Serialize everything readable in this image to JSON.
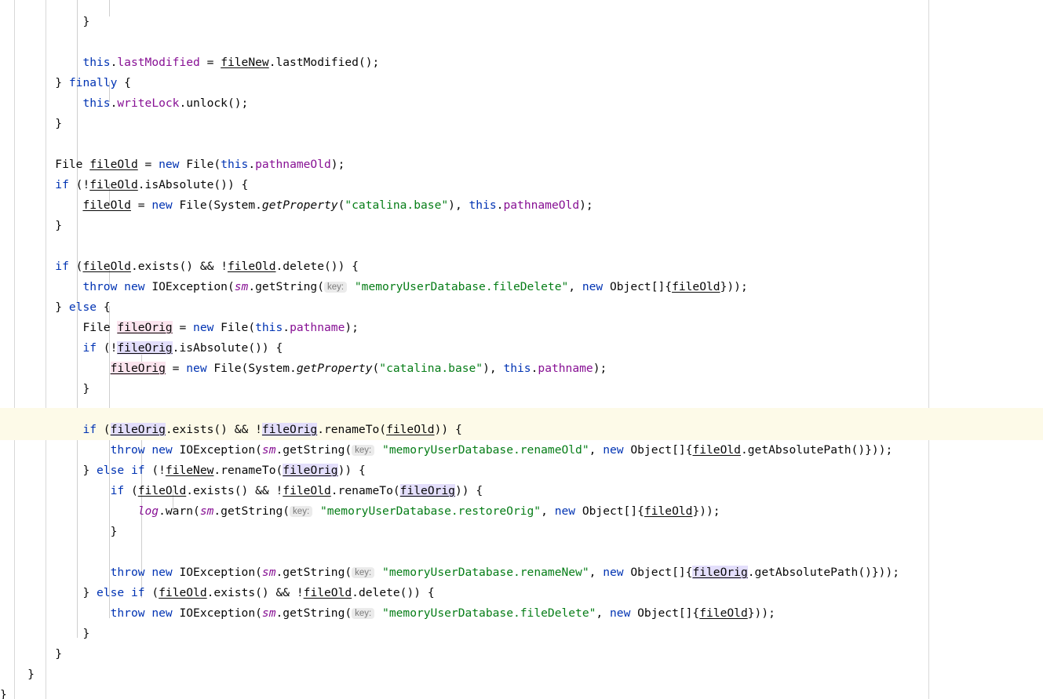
{
  "editor": {
    "language": "java",
    "font_size_px": 14.6,
    "line_height_px": 26,
    "background": "#ffffff",
    "caret_line_background": "#fdfae8",
    "indent_guide_color": "#d8d8d8",
    "right_margin_guide_x": 1183,
    "indent_guide_positions": [
      18,
      58,
      98,
      139,
      180
    ],
    "colors": {
      "keyword": "#0033B3",
      "string": "#067D17",
      "field": "#871094",
      "text": "#080808",
      "inline_hint_text": "#7a7a7a",
      "inline_hint_background": "#ebebeb",
      "read_occurrence": "#e3defb",
      "write_occurrence": "#fbe4ee"
    },
    "caret_line_index": 20
  },
  "inline_hints": {
    "key_label": "key:"
  },
  "code_lines": [
    {
      "indent": 3,
      "tokens": [
        {
          "t": "}",
          "c": "pln"
        }
      ]
    },
    {
      "indent": 0,
      "tokens": []
    },
    {
      "indent": 3,
      "tokens": [
        {
          "t": "this",
          "c": "kw"
        },
        {
          "t": ".",
          "c": "pln"
        },
        {
          "t": "lastModified",
          "c": "fld"
        },
        {
          "t": " = ",
          "c": "pln"
        },
        {
          "t": "fileNew",
          "c": "lv"
        },
        {
          "t": ".lastModified();",
          "c": "pln"
        }
      ]
    },
    {
      "indent": 2,
      "tokens": [
        {
          "t": "} ",
          "c": "pln"
        },
        {
          "t": "finally",
          "c": "kw"
        },
        {
          "t": " {",
          "c": "pln"
        }
      ]
    },
    {
      "indent": 3,
      "tokens": [
        {
          "t": "this",
          "c": "kw"
        },
        {
          "t": ".",
          "c": "pln"
        },
        {
          "t": "writeLock",
          "c": "fld"
        },
        {
          "t": ".unlock();",
          "c": "pln"
        }
      ]
    },
    {
      "indent": 2,
      "tokens": [
        {
          "t": "}",
          "c": "pln"
        }
      ]
    },
    {
      "indent": 0,
      "tokens": []
    },
    {
      "indent": 2,
      "tokens": [
        {
          "t": "File ",
          "c": "pln"
        },
        {
          "t": "fileOld",
          "c": "lv"
        },
        {
          "t": " = ",
          "c": "pln"
        },
        {
          "t": "new",
          "c": "kw"
        },
        {
          "t": " File(",
          "c": "pln"
        },
        {
          "t": "this",
          "c": "kw"
        },
        {
          "t": ".",
          "c": "pln"
        },
        {
          "t": "pathnameOld",
          "c": "fld"
        },
        {
          "t": ");",
          "c": "pln"
        }
      ]
    },
    {
      "indent": 2,
      "tokens": [
        {
          "t": "if",
          "c": "kw"
        },
        {
          "t": " (!",
          "c": "pln"
        },
        {
          "t": "fileOld",
          "c": "lv"
        },
        {
          "t": ".isAbsolute()) {",
          "c": "pln"
        }
      ]
    },
    {
      "indent": 3,
      "tokens": [
        {
          "t": "fileOld",
          "c": "lv"
        },
        {
          "t": " = ",
          "c": "pln"
        },
        {
          "t": "new",
          "c": "kw"
        },
        {
          "t": " File(System.",
          "c": "pln"
        },
        {
          "t": "getProperty",
          "c": "stm"
        },
        {
          "t": "(",
          "c": "pln"
        },
        {
          "t": "\"catalina.base\"",
          "c": "str"
        },
        {
          "t": "), ",
          "c": "pln"
        },
        {
          "t": "this",
          "c": "kw"
        },
        {
          "t": ".",
          "c": "pln"
        },
        {
          "t": "pathnameOld",
          "c": "fld"
        },
        {
          "t": ");",
          "c": "pln"
        }
      ]
    },
    {
      "indent": 2,
      "tokens": [
        {
          "t": "}",
          "c": "pln"
        }
      ]
    },
    {
      "indent": 0,
      "tokens": []
    },
    {
      "indent": 2,
      "tokens": [
        {
          "t": "if",
          "c": "kw"
        },
        {
          "t": " (",
          "c": "pln"
        },
        {
          "t": "fileOld",
          "c": "lv"
        },
        {
          "t": ".exists() && !",
          "c": "pln"
        },
        {
          "t": "fileOld",
          "c": "lv"
        },
        {
          "t": ".delete()) {",
          "c": "pln"
        }
      ]
    },
    {
      "indent": 3,
      "tokens": [
        {
          "t": "throw",
          "c": "kw"
        },
        {
          "t": " ",
          "c": "pln"
        },
        {
          "t": "new",
          "c": "kw"
        },
        {
          "t": " IOException(",
          "c": "pln"
        },
        {
          "t": "sm",
          "c": "fldi"
        },
        {
          "t": ".getString(",
          "c": "pln"
        },
        {
          "t": "key:",
          "c": "hint"
        },
        {
          "t": "\"memoryUserDatabase.fileDelete\"",
          "c": "str"
        },
        {
          "t": ", ",
          "c": "pln"
        },
        {
          "t": "new",
          "c": "kw"
        },
        {
          "t": " Object[]{",
          "c": "pln"
        },
        {
          "t": "fileOld",
          "c": "lv"
        },
        {
          "t": "}));",
          "c": "pln"
        }
      ]
    },
    {
      "indent": 2,
      "tokens": [
        {
          "t": "} ",
          "c": "pln"
        },
        {
          "t": "else",
          "c": "kw"
        },
        {
          "t": " {",
          "c": "pln"
        }
      ]
    },
    {
      "indent": 3,
      "tokens": [
        {
          "t": "File ",
          "c": "pln"
        },
        {
          "t": "fileOrig",
          "c": "lv occ-w"
        },
        {
          "t": " = ",
          "c": "pln"
        },
        {
          "t": "new",
          "c": "kw"
        },
        {
          "t": " File(",
          "c": "pln"
        },
        {
          "t": "this",
          "c": "kw"
        },
        {
          "t": ".",
          "c": "pln"
        },
        {
          "t": "pathname",
          "c": "fld"
        },
        {
          "t": ");",
          "c": "pln"
        }
      ]
    },
    {
      "indent": 3,
      "tokens": [
        {
          "t": "if",
          "c": "kw"
        },
        {
          "t": " (!",
          "c": "pln"
        },
        {
          "t": "fileOrig",
          "c": "lv occ-r"
        },
        {
          "t": ".isAbsolute()) {",
          "c": "pln"
        }
      ]
    },
    {
      "indent": 4,
      "tokens": [
        {
          "t": "fileOrig",
          "c": "lv occ-w"
        },
        {
          "t": " = ",
          "c": "pln"
        },
        {
          "t": "new",
          "c": "kw"
        },
        {
          "t": " File(System.",
          "c": "pln"
        },
        {
          "t": "getProperty",
          "c": "stm"
        },
        {
          "t": "(",
          "c": "pln"
        },
        {
          "t": "\"catalina.base\"",
          "c": "str"
        },
        {
          "t": "), ",
          "c": "pln"
        },
        {
          "t": "this",
          "c": "kw"
        },
        {
          "t": ".",
          "c": "pln"
        },
        {
          "t": "pathname",
          "c": "fld"
        },
        {
          "t": ");",
          "c": "pln"
        }
      ]
    },
    {
      "indent": 3,
      "tokens": [
        {
          "t": "}",
          "c": "pln"
        }
      ]
    },
    {
      "indent": 0,
      "tokens": []
    },
    {
      "indent": 3,
      "tokens": [
        {
          "t": "if",
          "c": "kw"
        },
        {
          "t": " (",
          "c": "pln"
        },
        {
          "t": "fileOrig",
          "c": "lv occ-r"
        },
        {
          "t": ".exists() && !",
          "c": "pln"
        },
        {
          "t": "fileOrig",
          "c": "lv occ-r"
        },
        {
          "t": ".renameTo(",
          "c": "pln"
        },
        {
          "t": "fileOld",
          "c": "lv"
        },
        {
          "t": ")) {",
          "c": "pln"
        }
      ]
    },
    {
      "indent": 4,
      "tokens": [
        {
          "t": "throw",
          "c": "kw"
        },
        {
          "t": " ",
          "c": "pln"
        },
        {
          "t": "new",
          "c": "kw"
        },
        {
          "t": " IOException(",
          "c": "pln"
        },
        {
          "t": "sm",
          "c": "fldi"
        },
        {
          "t": ".getString(",
          "c": "pln"
        },
        {
          "t": "key:",
          "c": "hint"
        },
        {
          "t": "\"memoryUserDatabase.renameOld\"",
          "c": "str"
        },
        {
          "t": ", ",
          "c": "pln"
        },
        {
          "t": "new",
          "c": "kw"
        },
        {
          "t": " Object[]{",
          "c": "pln"
        },
        {
          "t": "fileOld",
          "c": "lv"
        },
        {
          "t": ".getAbsolutePath()}));",
          "c": "pln"
        }
      ]
    },
    {
      "indent": 3,
      "tokens": [
        {
          "t": "} ",
          "c": "pln"
        },
        {
          "t": "else",
          "c": "kw"
        },
        {
          "t": " ",
          "c": "pln"
        },
        {
          "t": "if",
          "c": "kw"
        },
        {
          "t": " (!",
          "c": "pln"
        },
        {
          "t": "fileNew",
          "c": "lv"
        },
        {
          "t": ".renameTo(",
          "c": "pln"
        },
        {
          "t": "fileOrig",
          "c": "lv occ-r"
        },
        {
          "t": ")) {",
          "c": "pln"
        }
      ]
    },
    {
      "indent": 4,
      "tokens": [
        {
          "t": "if",
          "c": "kw"
        },
        {
          "t": " (",
          "c": "pln"
        },
        {
          "t": "fileOld",
          "c": "lv"
        },
        {
          "t": ".exists() && !",
          "c": "pln"
        },
        {
          "t": "fileOld",
          "c": "lv"
        },
        {
          "t": ".renameTo(",
          "c": "pln"
        },
        {
          "t": "fileOrig",
          "c": "lv occ-r"
        },
        {
          "t": ")) {",
          "c": "pln"
        }
      ]
    },
    {
      "indent": 5,
      "tokens": [
        {
          "t": "log",
          "c": "fldi"
        },
        {
          "t": ".warn(",
          "c": "pln"
        },
        {
          "t": "sm",
          "c": "fldi"
        },
        {
          "t": ".getString(",
          "c": "pln"
        },
        {
          "t": "key:",
          "c": "hint"
        },
        {
          "t": "\"memoryUserDatabase.restoreOrig\"",
          "c": "str"
        },
        {
          "t": ", ",
          "c": "pln"
        },
        {
          "t": "new",
          "c": "kw"
        },
        {
          "t": " Object[]{",
          "c": "pln"
        },
        {
          "t": "fileOld",
          "c": "lv"
        },
        {
          "t": "}));",
          "c": "pln"
        }
      ]
    },
    {
      "indent": 4,
      "tokens": [
        {
          "t": "}",
          "c": "pln"
        }
      ]
    },
    {
      "indent": 0,
      "tokens": []
    },
    {
      "indent": 4,
      "tokens": [
        {
          "t": "throw",
          "c": "kw"
        },
        {
          "t": " ",
          "c": "pln"
        },
        {
          "t": "new",
          "c": "kw"
        },
        {
          "t": " IOException(",
          "c": "pln"
        },
        {
          "t": "sm",
          "c": "fldi"
        },
        {
          "t": ".getString(",
          "c": "pln"
        },
        {
          "t": "key:",
          "c": "hint"
        },
        {
          "t": "\"memoryUserDatabase.renameNew\"",
          "c": "str"
        },
        {
          "t": ", ",
          "c": "pln"
        },
        {
          "t": "new",
          "c": "kw"
        },
        {
          "t": " Object[]{",
          "c": "pln"
        },
        {
          "t": "fileOrig",
          "c": "lv occ-r"
        },
        {
          "t": ".getAbsolutePath()}));",
          "c": "pln"
        }
      ]
    },
    {
      "indent": 3,
      "tokens": [
        {
          "t": "} ",
          "c": "pln"
        },
        {
          "t": "else",
          "c": "kw"
        },
        {
          "t": " ",
          "c": "pln"
        },
        {
          "t": "if",
          "c": "kw"
        },
        {
          "t": " (",
          "c": "pln"
        },
        {
          "t": "fileOld",
          "c": "lv"
        },
        {
          "t": ".exists() && !",
          "c": "pln"
        },
        {
          "t": "fileOld",
          "c": "lv"
        },
        {
          "t": ".delete()) {",
          "c": "pln"
        }
      ]
    },
    {
      "indent": 4,
      "tokens": [
        {
          "t": "throw",
          "c": "kw"
        },
        {
          "t": " ",
          "c": "pln"
        },
        {
          "t": "new",
          "c": "kw"
        },
        {
          "t": " IOException(",
          "c": "pln"
        },
        {
          "t": "sm",
          "c": "fldi"
        },
        {
          "t": ".getString(",
          "c": "pln"
        },
        {
          "t": "key:",
          "c": "hint"
        },
        {
          "t": "\"memoryUserDatabase.fileDelete\"",
          "c": "str"
        },
        {
          "t": ", ",
          "c": "pln"
        },
        {
          "t": "new",
          "c": "kw"
        },
        {
          "t": " Object[]{",
          "c": "pln"
        },
        {
          "t": "fileOld",
          "c": "lv"
        },
        {
          "t": "}));",
          "c": "pln"
        }
      ]
    },
    {
      "indent": 3,
      "tokens": [
        {
          "t": "}",
          "c": "pln"
        }
      ]
    },
    {
      "indent": 2,
      "tokens": [
        {
          "t": "}",
          "c": "pln"
        }
      ]
    },
    {
      "indent": 1,
      "tokens": [
        {
          "t": "}",
          "c": "pln"
        }
      ]
    },
    {
      "indent": 0,
      "tokens": [
        {
          "t": "}",
          "c": "pln"
        }
      ]
    }
  ]
}
